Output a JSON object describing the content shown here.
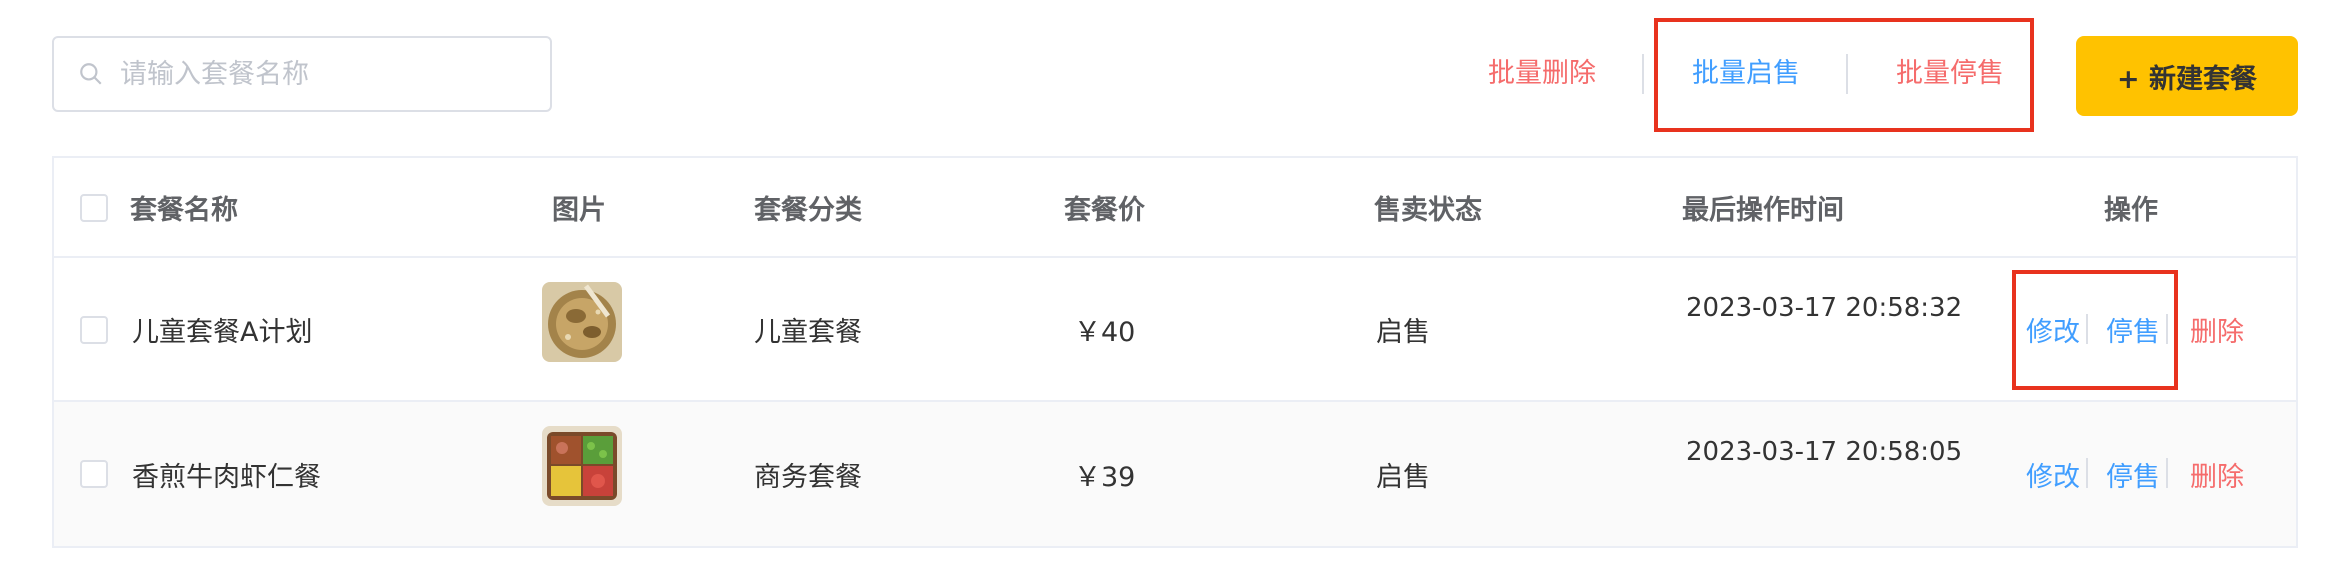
{
  "search": {
    "placeholder": "请输入套餐名称",
    "value": ""
  },
  "toolbar": {
    "batch_delete": "批量删除",
    "batch_enable": "批量启售",
    "batch_disable": "批量停售",
    "new_button": "+ 新建套餐"
  },
  "table": {
    "headers": [
      "套餐名称",
      "图片",
      "套餐分类",
      "套餐价",
      "售卖状态",
      "最后操作时间",
      "操作"
    ],
    "rows": [
      {
        "name": "儿童套餐A计划",
        "category": "儿童套餐",
        "price": "￥40",
        "status": "启售",
        "time": "2023-03-17 20:58:32",
        "edit": "修改",
        "toggle": "停售",
        "delete": "删除"
      },
      {
        "name": "香煎牛肉虾仁餐",
        "category": "商务套餐",
        "price": "￥39",
        "status": "启售",
        "time": "2023-03-17 20:58:05",
        "edit": "修改",
        "toggle": "停售",
        "delete": "删除"
      }
    ]
  },
  "colors": {
    "accent_yellow": "#ffc200",
    "link_blue": "#419eff",
    "danger_red": "#f56c6c",
    "highlight_red": "#e8321e"
  },
  "icons": {
    "search": "search-icon"
  }
}
